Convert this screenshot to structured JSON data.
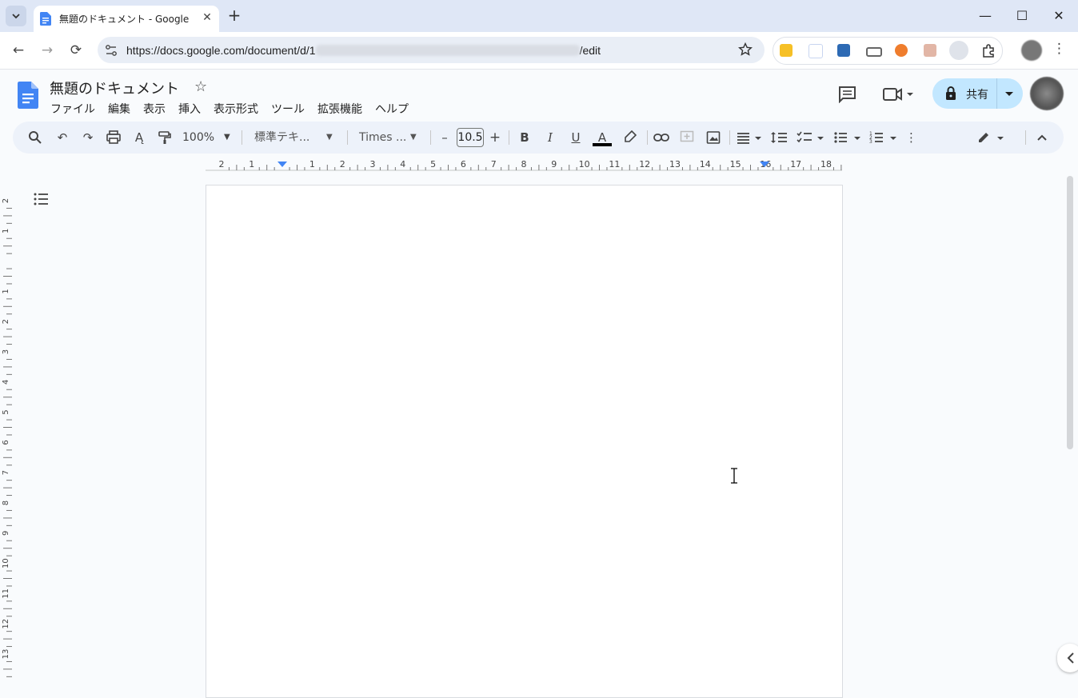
{
  "browser": {
    "tab_title": "無題のドキュメント - Google ドキュ",
    "tab_close": "✕",
    "new_tab": "+",
    "url_prefix": "https://docs.google.com/document/d/1",
    "url_suffix": "/edit",
    "window_controls": {
      "minimize": "—",
      "maximize": "☐",
      "close": "✕"
    },
    "nav": {
      "back": "←",
      "forward": "→",
      "reload": "⟳"
    }
  },
  "docs": {
    "title": "無題のドキュメント",
    "menu": [
      "ファイル",
      "編集",
      "表示",
      "挿入",
      "表示形式",
      "ツール",
      "拡張機能",
      "ヘルプ"
    ],
    "share_label": "共有",
    "toolbar": {
      "zoom": "100%",
      "style": "標準テキ...",
      "font": "Times ...",
      "font_size": "10.5",
      "minus": "–",
      "plus": "+",
      "bold": "B",
      "italic": "I",
      "underline": "U",
      "text_color": "A",
      "more": "⋮"
    },
    "ruler_h": [
      "2",
      "1",
      "",
      "1",
      "2",
      "3",
      "4",
      "5",
      "6",
      "7",
      "8",
      "9",
      "10",
      "11",
      "12",
      "13",
      "14",
      "15",
      "16",
      "17",
      "18"
    ],
    "ruler_v": [
      "2",
      "1",
      "",
      "1",
      "2",
      "3",
      "4",
      "5",
      "6",
      "7",
      "8",
      "9",
      "10",
      "11",
      "12",
      "13"
    ]
  },
  "colors": {
    "accent": "#1a73e8",
    "share_bg": "#c2e7ff",
    "toolbar_bg": "#edf2fa",
    "tabstrip_bg": "#dfe7f6"
  }
}
